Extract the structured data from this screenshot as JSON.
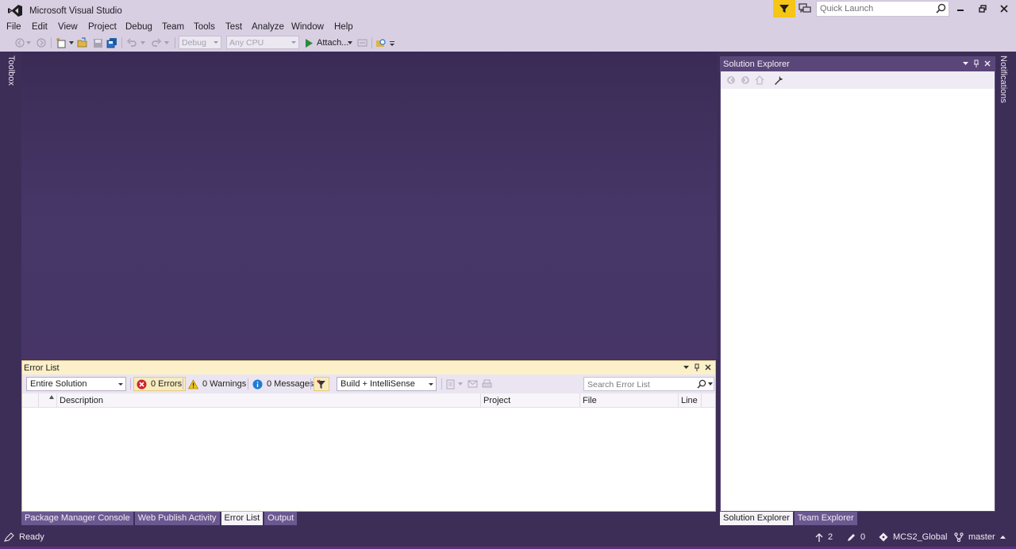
{
  "window": {
    "title": "Microsoft Visual Studio",
    "quick_launch_placeholder": "Quick Launch"
  },
  "menu": [
    {
      "label": "File"
    },
    {
      "label": "Edit"
    },
    {
      "label": "View"
    },
    {
      "label": "Project"
    },
    {
      "label": "Debug"
    },
    {
      "label": "Team"
    },
    {
      "label": "Tools"
    },
    {
      "label": "Test"
    },
    {
      "label": "Analyze"
    },
    {
      "label": "Window"
    },
    {
      "label": "Help"
    }
  ],
  "toolbar": {
    "config": "Debug",
    "platform": "Any CPU",
    "attach_label": "Attach..."
  },
  "side_tabs": {
    "toolbox": "Toolbox",
    "notifications": "Notifications"
  },
  "solution_explorer": {
    "title": "Solution Explorer"
  },
  "right_tabs": [
    {
      "label": "Solution Explorer",
      "active": true
    },
    {
      "label": "Team Explorer",
      "active": false
    }
  ],
  "error_list": {
    "title": "Error List",
    "scope": "Entire Solution",
    "errors_label": "0 Errors",
    "warnings_label": "0 Warnings",
    "messages_label": "0 Messages",
    "source": "Build + IntelliSense",
    "search_placeholder": "Search Error List",
    "columns": [
      "Description",
      "Project",
      "File",
      "Line"
    ]
  },
  "bottom_tabs": [
    {
      "label": "Package Manager Console",
      "active": false
    },
    {
      "label": "Web Publish Activity",
      "active": false
    },
    {
      "label": "Error List",
      "active": true
    },
    {
      "label": "Output",
      "active": false
    }
  ],
  "status": {
    "ready": "Ready",
    "push_count": "2",
    "changes_count": "0",
    "repo": "MCS2_Global",
    "branch": "master"
  },
  "colors": {
    "chrome": "#d8cfe3",
    "workspace": "#3c2e57",
    "pane_header": "#5a4678",
    "error_list_header": "#fcf0c9",
    "filter_accent": "#f5c518"
  }
}
